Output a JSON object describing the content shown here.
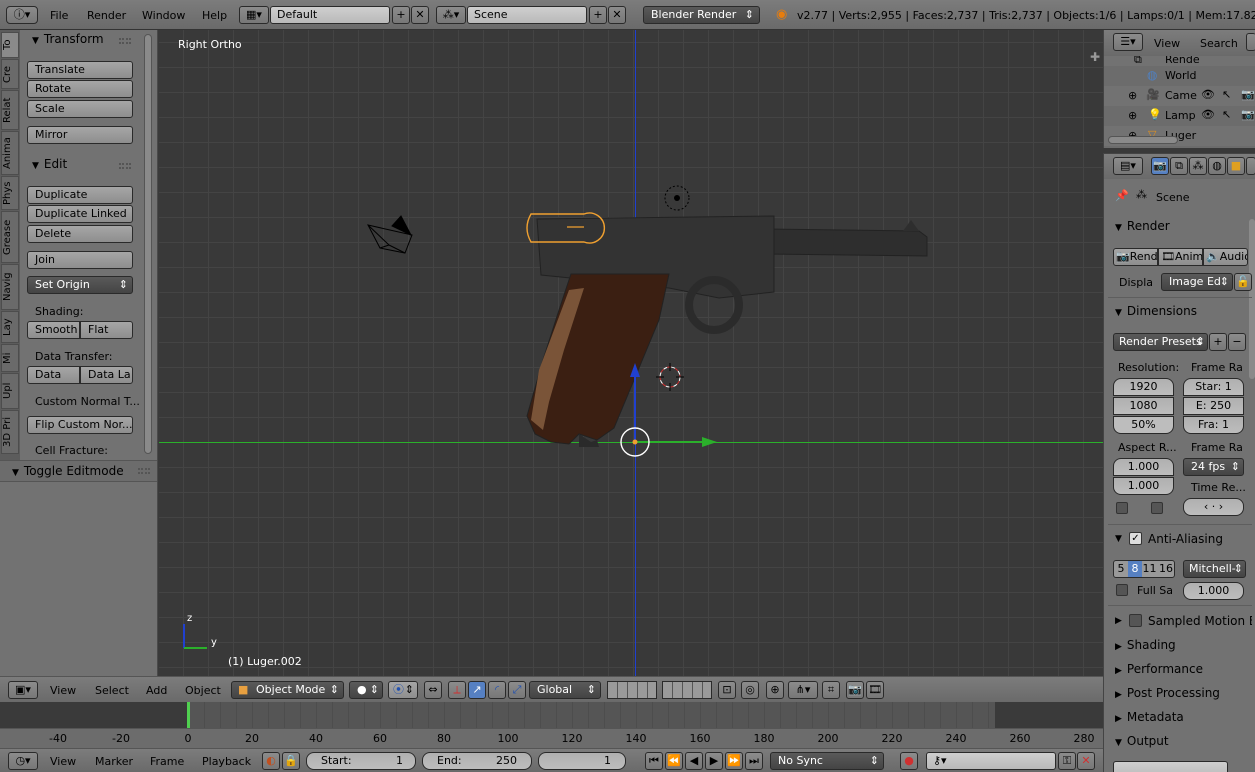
{
  "topbar": {
    "menus": [
      "File",
      "Render",
      "Window",
      "Help"
    ],
    "screen_layout": "Default",
    "scene": "Scene",
    "engine": "Blender Render",
    "stats": "v2.77 | Verts:2,955 | Faces:2,737 | Tris:2,737 | Objects:1/6 | Lamps:0/1 | Mem:17.82M | L"
  },
  "toolshelf": {
    "tabs": [
      "To",
      "Cre",
      "Relat",
      "Anima",
      "Phys",
      "Grease",
      "Navig",
      "Lay",
      "Mi",
      "Upl",
      "3D Pri"
    ],
    "transform_title": "Transform",
    "translate": "Translate",
    "rotate": "Rotate",
    "scale": "Scale",
    "mirror": "Mirror",
    "edit_title": "Edit",
    "duplicate": "Duplicate",
    "duplicate_linked": "Duplicate Linked",
    "delete": "Delete",
    "join": "Join",
    "set_origin": "Set Origin",
    "shading_label": "Shading:",
    "smooth": "Smooth",
    "flat": "Flat",
    "data_transfer_label": "Data Transfer:",
    "data": "Data",
    "data_la": "Data La",
    "custom_normal": "Custom Normal T...",
    "flip_custom": "Flip Custom Nor...",
    "cell_fracture": "Cell Fracture:",
    "toggle_editmode": "Toggle Editmode"
  },
  "viewport": {
    "view_label": "Right Ortho",
    "object_label": "(1) Luger.002",
    "axis_z": "z",
    "axis_y": "y"
  },
  "view3d_header": {
    "menus": [
      "View",
      "Select",
      "Add",
      "Object"
    ],
    "mode": "Object Mode",
    "orientation": "Global"
  },
  "timeline": {
    "ticks": [
      "-40",
      "-20",
      "0",
      "20",
      "40",
      "60",
      "80",
      "100",
      "120",
      "140",
      "160",
      "180",
      "200",
      "220",
      "240",
      "260",
      "280"
    ],
    "current_frame_marker": 1
  },
  "timeline_header": {
    "menus": [
      "View",
      "Marker",
      "Frame",
      "Playback"
    ],
    "start_label": "Start:",
    "start_value": "1",
    "end_label": "End:",
    "end_value": "250",
    "current": "1",
    "sync": "No Sync"
  },
  "outliner": {
    "menus": [
      "View",
      "Search"
    ],
    "items": [
      {
        "name": "Rende"
      },
      {
        "name": "World"
      },
      {
        "name": "Came"
      },
      {
        "name": "Lamp"
      },
      {
        "name": "Luger"
      }
    ]
  },
  "properties": {
    "scene_label": "Scene",
    "render_title": "Render",
    "render_btn": "Rend",
    "anim_btn": "Anim",
    "audio_btn": "Audio",
    "display_label": "Displa",
    "display_value": "Image Ed",
    "dimensions_title": "Dimensions",
    "render_presets": "Render Presets",
    "resolution_label": "Resolution:",
    "frame_range_label": "Frame Ra",
    "res_x": "1920",
    "res_y": "1080",
    "res_pct": "50%",
    "start_frame": "Star: 1",
    "end_frame": "E: 250",
    "frame_step": "Fra: 1",
    "aspect_label": "Aspect R...",
    "frame_rate_label": "Frame Ra",
    "aspect_x": "1.000",
    "aspect_y": "1.000",
    "fps": "24 fps",
    "time_remap_label": "Time Re...",
    "aa_title": "Anti-Aliasing",
    "aa_samples": [
      "5",
      "8",
      "11",
      "16"
    ],
    "aa_selected": "8",
    "aa_filter": "Mitchell-",
    "full_sample": "Full Sa",
    "filter_size": "1.000",
    "sampled_motion_blur": "Sampled Motion Bl",
    "shading": "Shading",
    "performance": "Performance",
    "post_processing": "Post Processing",
    "metadata": "Metadata",
    "output": "Output"
  },
  "colors": {
    "accent_blue": "#5680c2",
    "selection_orange": "#f0a030",
    "x_axis_green": "#2bb02b",
    "z_axis_blue": "#2040d0",
    "frame_green": "#50d050"
  }
}
